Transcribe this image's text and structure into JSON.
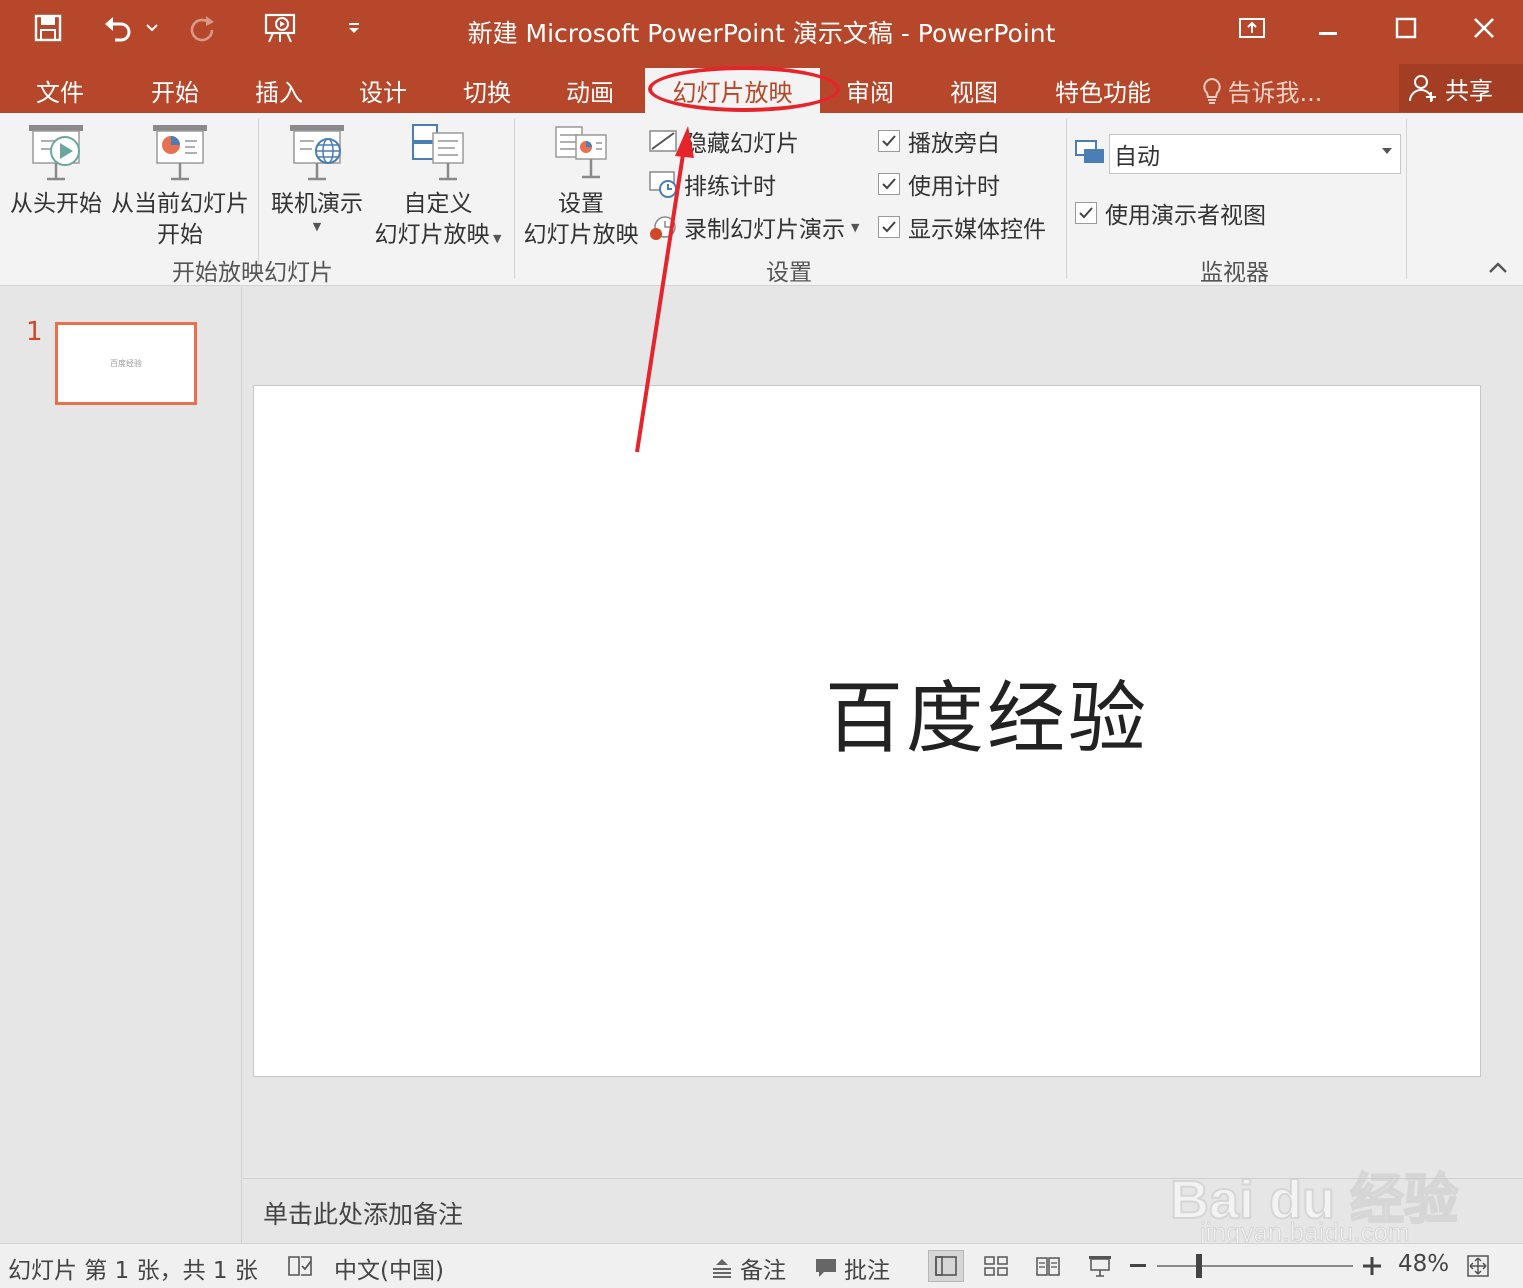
{
  "titlebar": {
    "title": "新建 Microsoft PowerPoint 演示文稿 - PowerPoint"
  },
  "tabs": [
    {
      "label": "文件"
    },
    {
      "label": "开始"
    },
    {
      "label": "插入"
    },
    {
      "label": "设计"
    },
    {
      "label": "切换"
    },
    {
      "label": "动画"
    },
    {
      "label": "幻灯片放映",
      "active": true
    },
    {
      "label": "审阅"
    },
    {
      "label": "视图"
    },
    {
      "label": "特色功能"
    }
  ],
  "tell_me": "告诉我...",
  "share": "共享",
  "ribbon": {
    "start_group": {
      "from_beginning": "从头开始",
      "from_current_line1": "从当前幻灯片",
      "from_current_line2": "开始",
      "online": "联机演示",
      "custom_line1": "自定义",
      "custom_line2": "幻灯片放映",
      "label": "开始放映幻灯片"
    },
    "setup_group": {
      "setup_line1": "设置",
      "setup_line2": "幻灯片放映",
      "hide_slide": "隐藏幻灯片",
      "rehearse": "排练计时",
      "record": "录制幻灯片演示",
      "play_narrations": "播放旁白",
      "use_timings": "使用计时",
      "show_media_controls": "显示媒体控件",
      "label": "设置"
    },
    "monitors_group": {
      "monitor_value": "自动",
      "presenter_view": "使用演示者视图",
      "label": "监视器"
    }
  },
  "thumbnails": [
    {
      "number": "1",
      "text": "百度经验"
    }
  ],
  "slide": {
    "title": "百度经验"
  },
  "notes_placeholder": "单击此处添加备注",
  "statusbar": {
    "slide_info": "幻灯片 第 1 张，共 1 张",
    "language": "中文(中国)",
    "notes": "备注",
    "comments": "批注",
    "zoom": "48%",
    "zoom_level": 0.48
  },
  "watermark": {
    "brand": "Bai du 经验",
    "url": "jingyan.baidu.com"
  },
  "colors": {
    "accent": "#b7472a",
    "annotation": "#e5252b"
  }
}
